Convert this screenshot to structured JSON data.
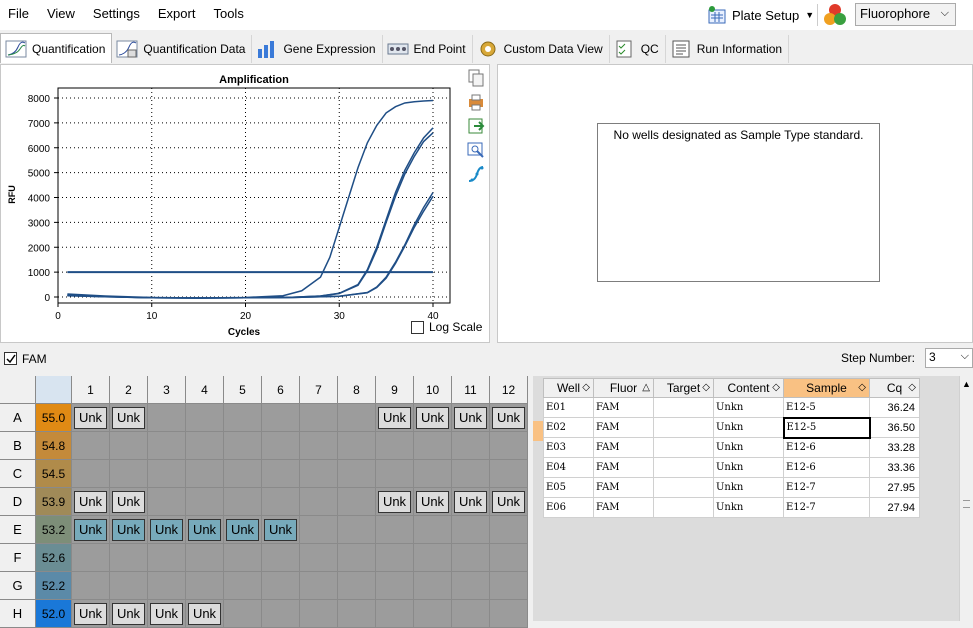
{
  "menu": [
    "File",
    "View",
    "Settings",
    "Export",
    "Tools"
  ],
  "toolbar": {
    "plate_setup": "Plate Setup",
    "fluorophore": "Fluorophore"
  },
  "tabs": [
    "Quantification",
    "Quantification Data",
    "Gene Expression",
    "End Point",
    "Custom Data View",
    "QC",
    "Run Information"
  ],
  "chart_data": {
    "type": "line",
    "title": "Amplification",
    "xlabel": "Cycles",
    "ylabel": "RFU",
    "xlim": [
      0,
      40
    ],
    "ylim": [
      0,
      8000
    ],
    "xticks": [
      "0",
      "10",
      "20",
      "30",
      "40"
    ],
    "yticks": [
      "0",
      "1000",
      "2000",
      "3000",
      "4000",
      "5000",
      "6000",
      "7000",
      "8000"
    ],
    "grid": true,
    "threshold": 1000,
    "series": [
      {
        "x": [
          1,
          5,
          10,
          15,
          20,
          24,
          26,
          28,
          29,
          30,
          31,
          32,
          33,
          34,
          35,
          36,
          37,
          38,
          39,
          40
        ],
        "y": [
          120,
          40,
          -20,
          -40,
          -20,
          50,
          250,
          800,
          1600,
          2800,
          4000,
          5200,
          6200,
          6900,
          7400,
          7650,
          7800,
          7850,
          7880,
          7900
        ]
      },
      {
        "x": [
          1,
          5,
          10,
          15,
          20,
          25,
          28,
          30,
          32,
          33,
          34,
          35,
          36,
          37,
          38,
          39,
          40
        ],
        "y": [
          80,
          20,
          -30,
          -40,
          -30,
          -10,
          40,
          150,
          500,
          1100,
          2000,
          3100,
          4200,
          5100,
          5800,
          6400,
          6800
        ]
      },
      {
        "x": [
          1,
          5,
          10,
          15,
          20,
          25,
          28,
          30,
          32,
          33,
          34,
          35,
          36,
          37,
          38,
          39,
          40
        ],
        "y": [
          70,
          20,
          -30,
          -40,
          -30,
          -10,
          40,
          140,
          470,
          1050,
          1900,
          3000,
          4050,
          4950,
          5650,
          6250,
          6600
        ]
      },
      {
        "x": [
          1,
          5,
          10,
          15,
          20,
          25,
          30,
          33,
          34,
          35,
          36,
          37,
          38,
          39,
          40
        ],
        "y": [
          60,
          10,
          -30,
          -40,
          -30,
          -20,
          30,
          180,
          400,
          800,
          1400,
          2100,
          2900,
          3600,
          4200
        ]
      },
      {
        "x": [
          1,
          5,
          10,
          15,
          20,
          25,
          30,
          33,
          34,
          35,
          36,
          37,
          38,
          39,
          40
        ],
        "y": [
          50,
          10,
          -30,
          -40,
          -30,
          -20,
          30,
          170,
          380,
          760,
          1350,
          2050,
          2800,
          3450,
          4050
        ]
      }
    ]
  },
  "log_scale_label": "Log Scale",
  "standard_message": "No wells designated as Sample Type standard.",
  "fam_label": "FAM",
  "step_label": "Step Number:",
  "step_value": "3",
  "plate": {
    "columns": [
      "1",
      "2",
      "3",
      "4",
      "5",
      "6",
      "7",
      "8",
      "9",
      "10",
      "11",
      "12"
    ],
    "rows": [
      {
        "letter": "A",
        "temp": "55.0",
        "color": "#e08a14",
        "wells": [
          "Unk",
          "Unk",
          "",
          "",
          "",
          "",
          "",
          "",
          "Unk",
          "Unk",
          "Unk",
          "Unk"
        ]
      },
      {
        "letter": "B",
        "temp": "54.8",
        "color": "#c48a3a",
        "wells": [
          "",
          "",
          "",
          "",
          "",
          "",
          "",
          "",
          "",
          "",
          "",
          ""
        ]
      },
      {
        "letter": "C",
        "temp": "54.5",
        "color": "#b08b4a",
        "wells": [
          "",
          "",
          "",
          "",
          "",
          "",
          "",
          "",
          "",
          "",
          "",
          ""
        ]
      },
      {
        "letter": "D",
        "temp": "53.9",
        "color": "#a08a58",
        "wells": [
          "Unk",
          "Unk",
          "",
          "",
          "",
          "",
          "",
          "",
          "Unk",
          "Unk",
          "Unk",
          "Unk"
        ]
      },
      {
        "letter": "E",
        "temp": "53.2",
        "color": "#7d8e78",
        "wells": [
          "Unk",
          "Unk",
          "Unk",
          "Unk",
          "Unk",
          "Unk",
          "",
          "",
          "",
          "",
          "",
          ""
        ]
      },
      {
        "letter": "F",
        "temp": "52.6",
        "color": "#6a8d94",
        "wells": [
          "",
          "",
          "",
          "",
          "",
          "",
          "",
          "",
          "",
          "",
          "",
          ""
        ]
      },
      {
        "letter": "G",
        "temp": "52.2",
        "color": "#5b8aa8",
        "wells": [
          "",
          "",
          "",
          "",
          "",
          "",
          "",
          "",
          "",
          "",
          "",
          ""
        ]
      },
      {
        "letter": "H",
        "temp": "52.0",
        "color": "#1a78d8",
        "wells": [
          "Unk",
          "Unk",
          "Unk",
          "Unk",
          "",
          "",
          "",
          "",
          "",
          "",
          "",
          ""
        ]
      }
    ],
    "selected_row": "E"
  },
  "table": {
    "headers": [
      "Well",
      "Fluor",
      "Target",
      "Content",
      "Sample",
      "Cq"
    ],
    "rows": [
      [
        "E01",
        "FAM",
        "",
        "Unkn",
        "E12-5",
        "36.24"
      ],
      [
        "E02",
        "FAM",
        "",
        "Unkn",
        "E12-5",
        "36.50"
      ],
      [
        "E03",
        "FAM",
        "",
        "Unkn",
        "E12-6",
        "33.28"
      ],
      [
        "E04",
        "FAM",
        "",
        "Unkn",
        "E12-6",
        "33.36"
      ],
      [
        "E05",
        "FAM",
        "",
        "Unkn",
        "E12-7",
        "27.95"
      ],
      [
        "E06",
        "FAM",
        "",
        "Unkn",
        "E12-7",
        "27.94"
      ]
    ]
  }
}
